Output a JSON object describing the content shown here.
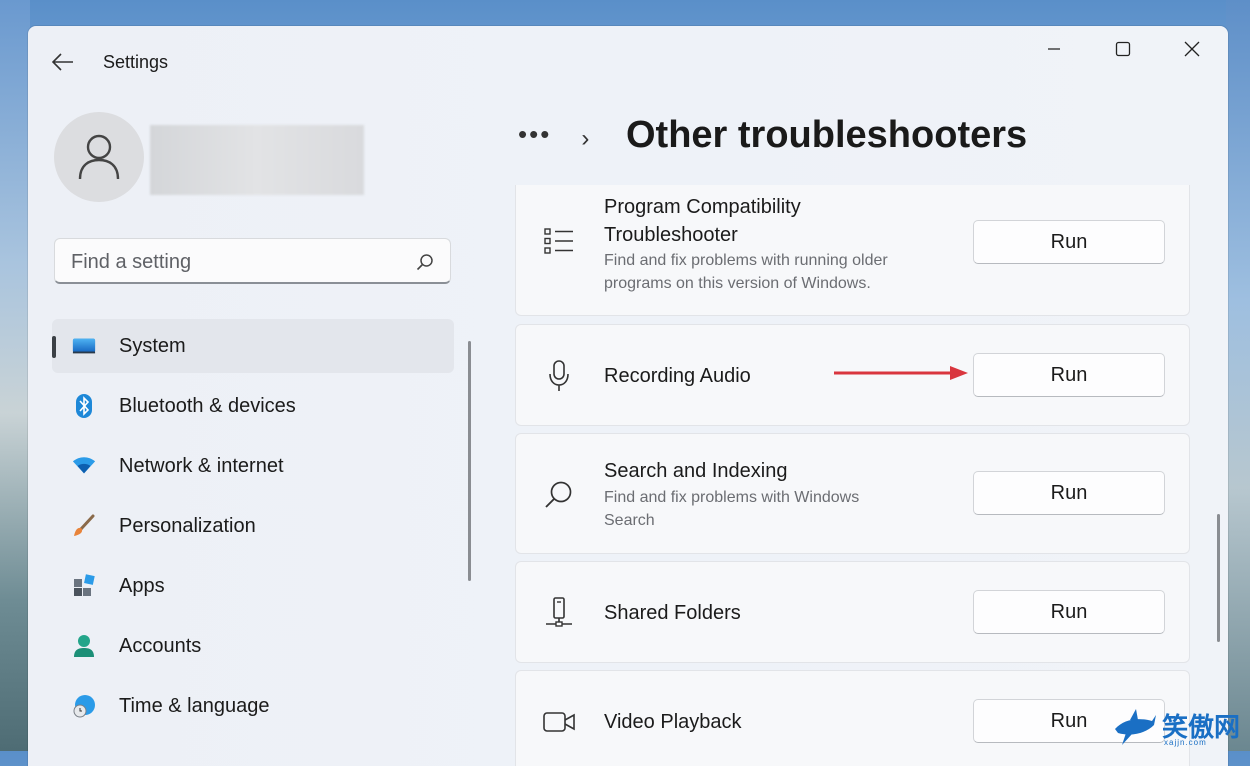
{
  "window": {
    "title": "Settings"
  },
  "search": {
    "placeholder": "Find a setting"
  },
  "nav": [
    {
      "label": "System",
      "icon": "system-icon",
      "active": true
    },
    {
      "label": "Bluetooth & devices",
      "icon": "bluetooth-icon"
    },
    {
      "label": "Network & internet",
      "icon": "wifi-icon"
    },
    {
      "label": "Personalization",
      "icon": "brush-icon"
    },
    {
      "label": "Apps",
      "icon": "apps-icon"
    },
    {
      "label": "Accounts",
      "icon": "accounts-icon"
    },
    {
      "label": "Time & language",
      "icon": "globe-clock-icon"
    }
  ],
  "breadcrumb": {
    "more": "•••",
    "title": "Other troubleshooters"
  },
  "troubleshooters": [
    {
      "title": "Program Compatibility Troubleshooter",
      "title_line1": "Program Compatibility",
      "title_line2": "Troubleshooter",
      "desc_line1": "Find and fix problems with running older",
      "desc_line2": "programs on this version of Windows.",
      "button": "Run",
      "icon": "list-icon"
    },
    {
      "title": "Recording Audio",
      "button": "Run",
      "icon": "microphone-icon"
    },
    {
      "title": "Search and Indexing",
      "desc_line1": "Find and fix problems with Windows",
      "desc_line2": "Search",
      "button": "Run",
      "icon": "search-icon"
    },
    {
      "title": "Shared Folders",
      "button": "Run",
      "icon": "network-drive-icon"
    },
    {
      "title": "Video Playback",
      "button": "Run",
      "icon": "video-camera-icon"
    }
  ],
  "watermark": {
    "text": "笑傲网",
    "sub": "xajjn.com"
  },
  "colors": {
    "accent": "#0067c0",
    "arrow": "#d9363e",
    "active_nav_bg": "#e3e6ec"
  }
}
